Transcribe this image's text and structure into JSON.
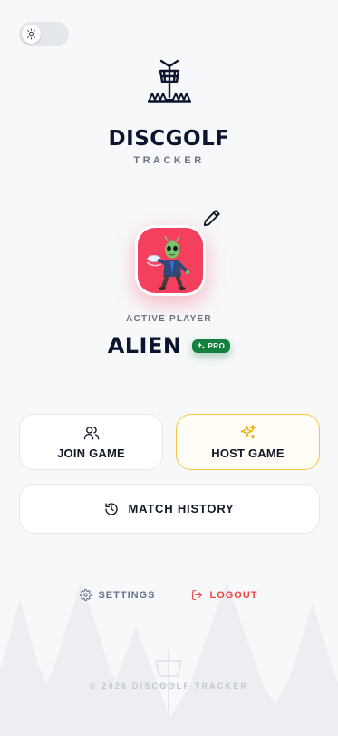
{
  "app": {
    "title": "DISCGOLF",
    "subtitle": "TRACKER"
  },
  "theme_toggle": {
    "mode": "light",
    "icon": "sun-icon"
  },
  "player": {
    "section_label": "ACTIVE PLAYER",
    "name": "ALIEN",
    "badge": "PRO",
    "avatar_color": "#f43f5e"
  },
  "actions": {
    "join": {
      "label": "JOIN GAME",
      "icon": "users-icon"
    },
    "host": {
      "label": "HOST GAME",
      "icon": "sparkles-icon",
      "accent": "#f5c542"
    },
    "history": {
      "label": "MATCH HISTORY",
      "icon": "history-icon"
    }
  },
  "footer": {
    "settings": "SETTINGS",
    "logout": "LOGOUT",
    "copyright": "© 2026 DISCGOLF TRACKER"
  },
  "colors": {
    "primary_text": "#0b1530",
    "pro_green": "#15803d",
    "logout_red": "#ef4444",
    "host_border": "#f5c542"
  }
}
